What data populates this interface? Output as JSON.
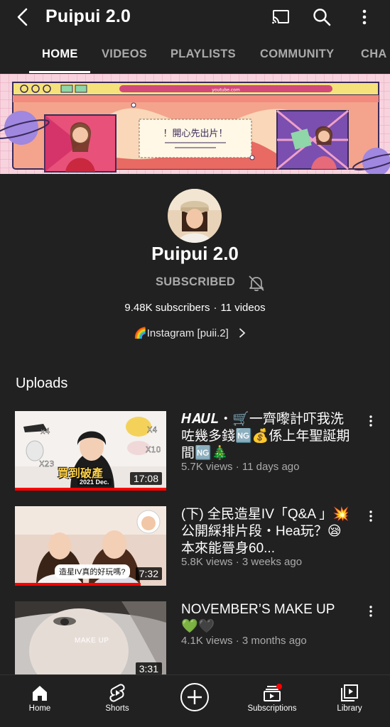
{
  "header": {
    "title": "Puipui 2.0"
  },
  "tabs": [
    {
      "label": "HOME"
    },
    {
      "label": "VIDEOS"
    },
    {
      "label": "PLAYLISTS"
    },
    {
      "label": "COMMUNITY"
    },
    {
      "label": "CHA"
    }
  ],
  "banner": {
    "sign_text": "！開心先出片！",
    "url_text": "youtube.com"
  },
  "channel": {
    "name": "Puipui 2.0",
    "subscribe_state": "SUBSCRIBED",
    "subscribers": "9.48K subscribers",
    "separator": "·",
    "videos": "11 videos",
    "link_text": "Instagram [puii.2]",
    "link_emoji": "🌈"
  },
  "uploads_heading": "Uploads",
  "videos": [
    {
      "title": "𝑯𝑨𝑼𝑳・🛒一齊嚟計吓我洗咗幾多錢🆖💰係上年聖誕期間🆖🎄",
      "meta": "5.7K views · 11 days ago",
      "duration": "17:08",
      "progress": 1.0,
      "thumb_caption": "買到破產",
      "thumb_sub": "2021 Dec."
    },
    {
      "title": "(下) 全民造星IV「Q&A 」💥 公開綵排片段・Hea玩？😪本來能晉身60...",
      "meta": "5.8K views · 3 weeks ago",
      "duration": "7:32",
      "progress": 0.83,
      "thumb_caption": "造星IV真的好玩嗎?"
    },
    {
      "title": "NOVEMBER’S MAKE UP 💚🖤",
      "meta": "4.1K views · 3 months ago",
      "duration": "3:31",
      "progress": 0,
      "thumb_caption": "MAKE UP"
    }
  ],
  "bottom_nav": [
    {
      "label": "Home",
      "icon": "home-icon"
    },
    {
      "label": "Shorts",
      "icon": "shorts-icon"
    },
    {
      "label": "",
      "icon": "create-icon"
    },
    {
      "label": "Subscriptions",
      "icon": "subscriptions-icon"
    },
    {
      "label": "Library",
      "icon": "library-icon"
    }
  ],
  "colors": {
    "background": "#212121",
    "accent": "#ff0000",
    "muted_text": "#aaaaaa"
  }
}
